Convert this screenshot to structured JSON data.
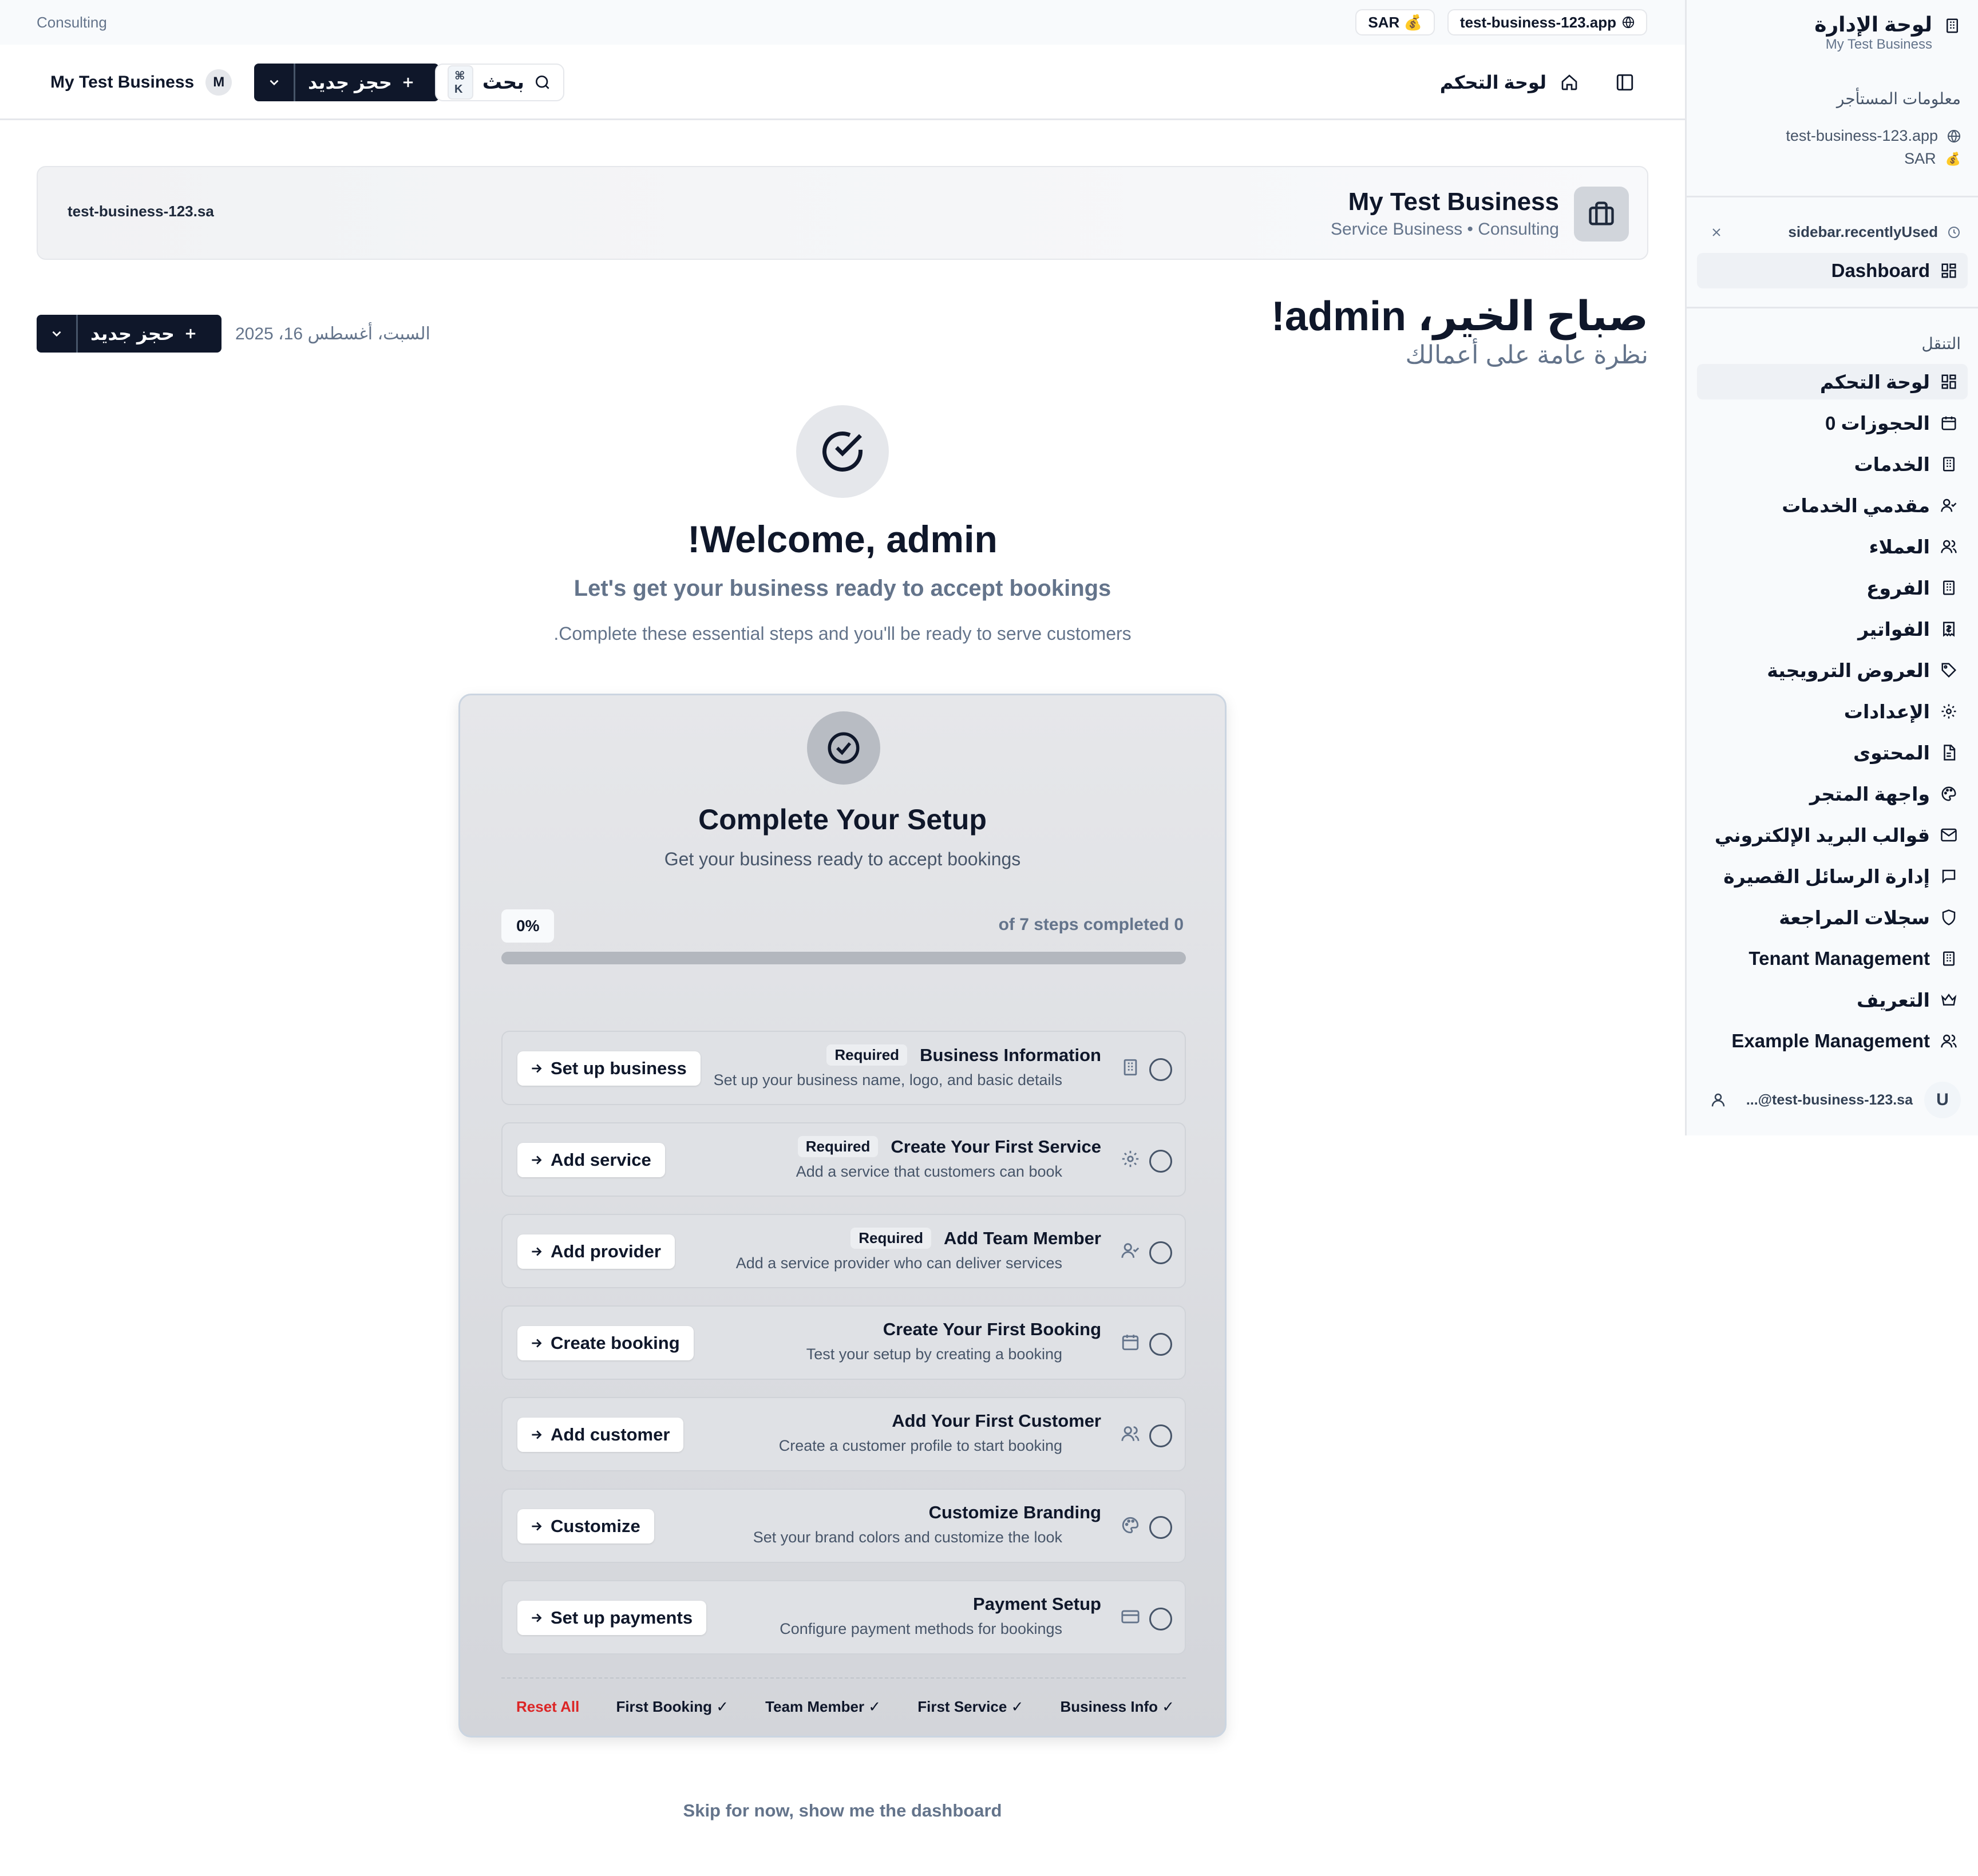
{
  "top_strip": {
    "industry": "Consulting",
    "currency": "SAR 💰",
    "domain": "test-business-123.app"
  },
  "header": {
    "business_name": "My Test Business",
    "avatar_initial": "M",
    "new_booking_label": "حجز جديد",
    "search_label": "بحث",
    "search_shortcut": "⌘ K",
    "page_title": "لوحة التحكم"
  },
  "business_card": {
    "domain": "test-business-123.sa",
    "name": "My Test Business",
    "subtitle": "Service Business • Consulting"
  },
  "greeting": {
    "title": "صباح الخير، admin!",
    "subtitle": "نظرة عامة على أعمالك",
    "date": "السبت، أغسطس 16، 2025",
    "new_booking_label": "حجز جديد"
  },
  "welcome": {
    "title": "!Welcome, admin",
    "subtitle": "Let's get your business ready to accept bookings",
    "description": ".Complete these essential steps and you'll be ready to serve customers"
  },
  "setup": {
    "title": "Complete Your Setup",
    "subtitle": "Get your business ready to accept bookings",
    "percent_label": "0%",
    "progress": 0,
    "steps_completed": "0 of 7 steps completed",
    "required_label": "Required",
    "steps": [
      {
        "title": "Business Information",
        "description": "Set up your business name, logo, and basic details",
        "action": "Set up business",
        "required": true,
        "icon": "building-icon"
      },
      {
        "title": "Create Your First Service",
        "description": "Add a service that customers can book",
        "action": "Add service",
        "required": true,
        "icon": "gear-icon"
      },
      {
        "title": "Add Team Member",
        "description": "Add a service provider who can deliver services",
        "action": "Add provider",
        "required": true,
        "icon": "user-check-icon"
      },
      {
        "title": "Create Your First Booking",
        "description": "Test your setup by creating a booking",
        "action": "Create booking",
        "required": false,
        "icon": "calendar-icon"
      },
      {
        "title": "Add Your First Customer",
        "description": "Create a customer profile to start booking",
        "action": "Add customer",
        "required": false,
        "icon": "users-icon"
      },
      {
        "title": "Customize Branding",
        "description": "Set your brand colors and customize the look",
        "action": "Customize",
        "required": false,
        "icon": "palette-icon"
      },
      {
        "title": "Payment Setup",
        "description": "Configure payment methods for bookings",
        "action": "Set up payments",
        "required": false,
        "icon": "credit-card-icon"
      }
    ],
    "footer": {
      "reset": "Reset All",
      "first_booking": "First Booking ✓",
      "team_member": "Team Member ✓",
      "first_service": "First Service ✓",
      "business_info": "Business Info ✓"
    }
  },
  "skip_label": "Skip for now, show me the dashboard",
  "sidebar": {
    "title": "لوحة الإدارة",
    "subtitle": "My Test Business",
    "tenant_info_label": "معلومات المستأجر",
    "tenant_domain": "test-business-123.app",
    "tenant_currency": "SAR",
    "recently_used_label": "sidebar.recentlyUsed",
    "recent_item": "Dashboard",
    "nav_label": "التنقل",
    "nav_items": [
      {
        "label": "لوحة التحكم",
        "icon": "dashboard-icon",
        "active": true
      },
      {
        "label": "الحجوزات 0",
        "icon": "calendar-icon"
      },
      {
        "label": "الخدمات",
        "icon": "building-icon"
      },
      {
        "label": "مقدمي الخدمات",
        "icon": "user-check-icon"
      },
      {
        "label": "العملاء",
        "icon": "users-icon"
      },
      {
        "label": "الفروع",
        "icon": "building-icon"
      },
      {
        "label": "الفواتير",
        "icon": "receipt-icon"
      },
      {
        "label": "العروض الترويجية",
        "icon": "tag-icon"
      },
      {
        "label": "الإعدادات",
        "icon": "gear-icon"
      },
      {
        "label": "المحتوى",
        "icon": "document-icon"
      },
      {
        "label": "واجهة المتجر",
        "icon": "palette-icon"
      },
      {
        "label": "قوالب البريد الإلكتروني",
        "icon": "mail-icon"
      },
      {
        "label": "إدارة الرسائل القصيرة",
        "icon": "message-icon"
      },
      {
        "label": "سجلات المراجعة",
        "icon": "shield-icon"
      },
      {
        "label": "Tenant Management",
        "icon": "building-icon"
      },
      {
        "label": "التعريف",
        "icon": "crown-icon"
      },
      {
        "label": "Example Management",
        "icon": "users-icon"
      }
    ],
    "user_email": "...@test-business-123.sa",
    "user_initial": "U"
  }
}
